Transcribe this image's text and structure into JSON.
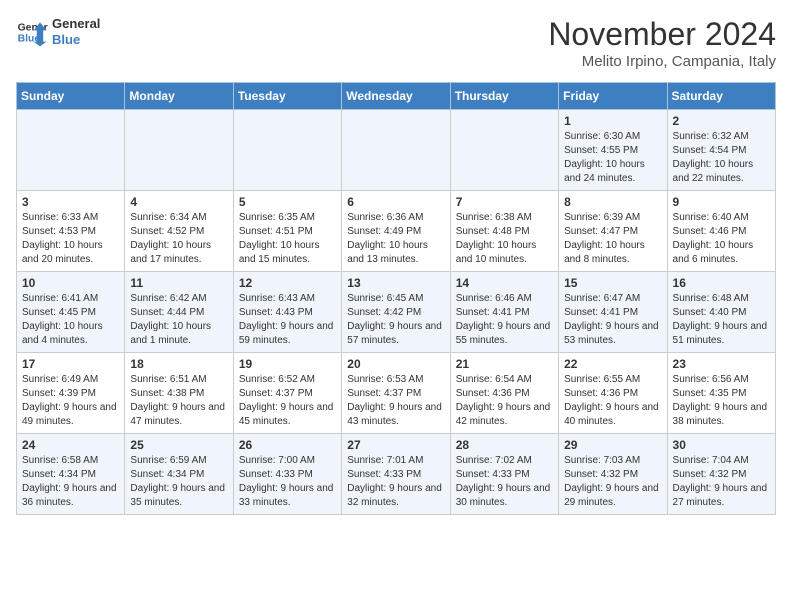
{
  "header": {
    "logo_line1": "General",
    "logo_line2": "Blue",
    "month": "November 2024",
    "location": "Melito Irpino, Campania, Italy"
  },
  "days_of_week": [
    "Sunday",
    "Monday",
    "Tuesday",
    "Wednesday",
    "Thursday",
    "Friday",
    "Saturday"
  ],
  "weeks": [
    [
      {
        "day": "",
        "content": ""
      },
      {
        "day": "",
        "content": ""
      },
      {
        "day": "",
        "content": ""
      },
      {
        "day": "",
        "content": ""
      },
      {
        "day": "",
        "content": ""
      },
      {
        "day": "1",
        "content": "Sunrise: 6:30 AM\nSunset: 4:55 PM\nDaylight: 10 hours and 24 minutes."
      },
      {
        "day": "2",
        "content": "Sunrise: 6:32 AM\nSunset: 4:54 PM\nDaylight: 10 hours and 22 minutes."
      }
    ],
    [
      {
        "day": "3",
        "content": "Sunrise: 6:33 AM\nSunset: 4:53 PM\nDaylight: 10 hours and 20 minutes."
      },
      {
        "day": "4",
        "content": "Sunrise: 6:34 AM\nSunset: 4:52 PM\nDaylight: 10 hours and 17 minutes."
      },
      {
        "day": "5",
        "content": "Sunrise: 6:35 AM\nSunset: 4:51 PM\nDaylight: 10 hours and 15 minutes."
      },
      {
        "day": "6",
        "content": "Sunrise: 6:36 AM\nSunset: 4:49 PM\nDaylight: 10 hours and 13 minutes."
      },
      {
        "day": "7",
        "content": "Sunrise: 6:38 AM\nSunset: 4:48 PM\nDaylight: 10 hours and 10 minutes."
      },
      {
        "day": "8",
        "content": "Sunrise: 6:39 AM\nSunset: 4:47 PM\nDaylight: 10 hours and 8 minutes."
      },
      {
        "day": "9",
        "content": "Sunrise: 6:40 AM\nSunset: 4:46 PM\nDaylight: 10 hours and 6 minutes."
      }
    ],
    [
      {
        "day": "10",
        "content": "Sunrise: 6:41 AM\nSunset: 4:45 PM\nDaylight: 10 hours and 4 minutes."
      },
      {
        "day": "11",
        "content": "Sunrise: 6:42 AM\nSunset: 4:44 PM\nDaylight: 10 hours and 1 minute."
      },
      {
        "day": "12",
        "content": "Sunrise: 6:43 AM\nSunset: 4:43 PM\nDaylight: 9 hours and 59 minutes."
      },
      {
        "day": "13",
        "content": "Sunrise: 6:45 AM\nSunset: 4:42 PM\nDaylight: 9 hours and 57 minutes."
      },
      {
        "day": "14",
        "content": "Sunrise: 6:46 AM\nSunset: 4:41 PM\nDaylight: 9 hours and 55 minutes."
      },
      {
        "day": "15",
        "content": "Sunrise: 6:47 AM\nSunset: 4:41 PM\nDaylight: 9 hours and 53 minutes."
      },
      {
        "day": "16",
        "content": "Sunrise: 6:48 AM\nSunset: 4:40 PM\nDaylight: 9 hours and 51 minutes."
      }
    ],
    [
      {
        "day": "17",
        "content": "Sunrise: 6:49 AM\nSunset: 4:39 PM\nDaylight: 9 hours and 49 minutes."
      },
      {
        "day": "18",
        "content": "Sunrise: 6:51 AM\nSunset: 4:38 PM\nDaylight: 9 hours and 47 minutes."
      },
      {
        "day": "19",
        "content": "Sunrise: 6:52 AM\nSunset: 4:37 PM\nDaylight: 9 hours and 45 minutes."
      },
      {
        "day": "20",
        "content": "Sunrise: 6:53 AM\nSunset: 4:37 PM\nDaylight: 9 hours and 43 minutes."
      },
      {
        "day": "21",
        "content": "Sunrise: 6:54 AM\nSunset: 4:36 PM\nDaylight: 9 hours and 42 minutes."
      },
      {
        "day": "22",
        "content": "Sunrise: 6:55 AM\nSunset: 4:36 PM\nDaylight: 9 hours and 40 minutes."
      },
      {
        "day": "23",
        "content": "Sunrise: 6:56 AM\nSunset: 4:35 PM\nDaylight: 9 hours and 38 minutes."
      }
    ],
    [
      {
        "day": "24",
        "content": "Sunrise: 6:58 AM\nSunset: 4:34 PM\nDaylight: 9 hours and 36 minutes."
      },
      {
        "day": "25",
        "content": "Sunrise: 6:59 AM\nSunset: 4:34 PM\nDaylight: 9 hours and 35 minutes."
      },
      {
        "day": "26",
        "content": "Sunrise: 7:00 AM\nSunset: 4:33 PM\nDaylight: 9 hours and 33 minutes."
      },
      {
        "day": "27",
        "content": "Sunrise: 7:01 AM\nSunset: 4:33 PM\nDaylight: 9 hours and 32 minutes."
      },
      {
        "day": "28",
        "content": "Sunrise: 7:02 AM\nSunset: 4:33 PM\nDaylight: 9 hours and 30 minutes."
      },
      {
        "day": "29",
        "content": "Sunrise: 7:03 AM\nSunset: 4:32 PM\nDaylight: 9 hours and 29 minutes."
      },
      {
        "day": "30",
        "content": "Sunrise: 7:04 AM\nSunset: 4:32 PM\nDaylight: 9 hours and 27 minutes."
      }
    ]
  ]
}
